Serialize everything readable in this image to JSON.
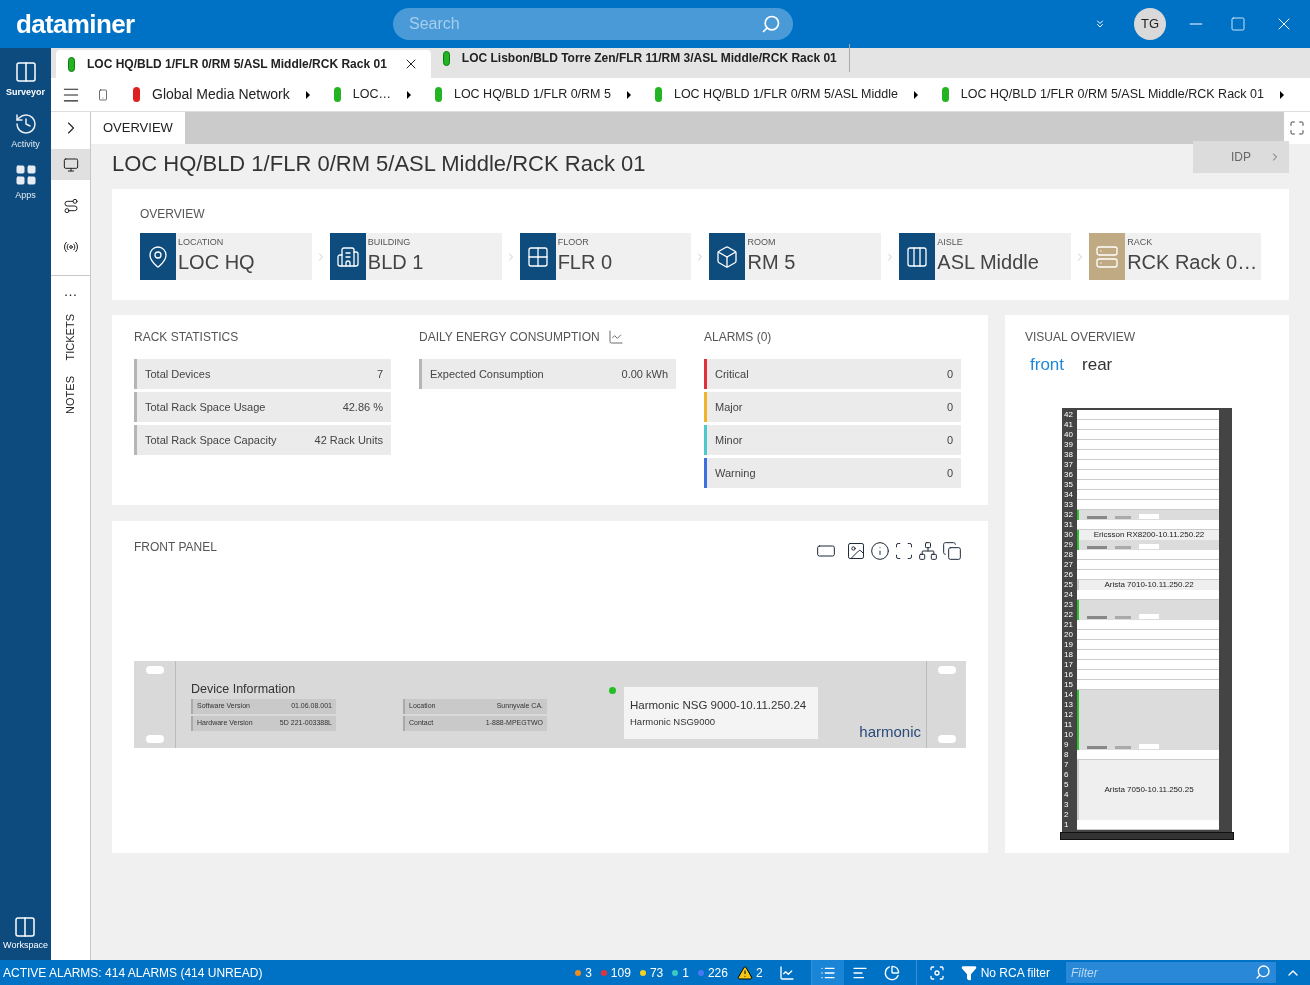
{
  "header": {
    "logo": "dataminer",
    "search": {
      "placeholder": "Search"
    },
    "avatar": "TG"
  },
  "rail": {
    "items": [
      {
        "kind": "surveyor",
        "label": "Surveyor",
        "selected": true
      },
      {
        "kind": "activity",
        "label": "Activity",
        "selected": false
      },
      {
        "kind": "apps",
        "label": "Apps",
        "selected": false
      }
    ],
    "workspace": "Workspace"
  },
  "tabs": [
    {
      "label": "LOC HQ/BLD 1/FLR 0/RM 5/ASL Middle/RCK Rack 01",
      "selected": true
    },
    {
      "label": "LOC Lisbon/BLD Torre Zen/FLR 11/RM 3/ASL Middle/RCK Rack 01",
      "selected": false
    }
  ],
  "breadcrumb": [
    {
      "label": "Global Media Network",
      "color": "#e02020"
    },
    {
      "label": "LOC…",
      "color": "#22b422"
    },
    {
      "label": "LOC HQ/BLD 1/FLR 0/RM 5",
      "color": "#22b422"
    },
    {
      "label": "LOC HQ/BLD 1/FLR 0/RM 5/ASL Middle",
      "color": "#22b422"
    },
    {
      "label": "LOC HQ/BLD 1/FLR 0/RM 5/ASL Middle/RCK Rack 01",
      "color": "#22b422"
    }
  ],
  "side_panel": {
    "tools": [
      {
        "kind": "card",
        "selected": true
      },
      {
        "kind": "route",
        "selected": false
      },
      {
        "kind": "broadcast",
        "selected": false
      }
    ],
    "more": "…",
    "vertical_tabs": [
      "TICKETS",
      "NOTES"
    ]
  },
  "page_tabs": [
    {
      "label": "OVERVIEW",
      "selected": true
    }
  ],
  "title": "LOC HQ/BLD 1/FLR 0/RM 5/ASL Middle/RCK Rack 01",
  "idp_button": "IDP",
  "overview": {
    "heading": "OVERVIEW",
    "items": [
      {
        "kind": "location",
        "caption": "LOCATION",
        "value": "LOC HQ"
      },
      {
        "kind": "building",
        "caption": "BUILDING",
        "value": "BLD 1"
      },
      {
        "kind": "floor",
        "caption": "FLOOR",
        "value": "FLR 0"
      },
      {
        "kind": "room",
        "caption": "ROOM",
        "value": "RM 5"
      },
      {
        "kind": "aisle",
        "caption": "AISLE",
        "value": "ASL Middle"
      },
      {
        "kind": "rack",
        "caption": "RACK",
        "value": "RCK Rack 0…"
      }
    ]
  },
  "rack_statistics": {
    "heading": "RACK STATISTICS",
    "rows": [
      {
        "label": "Total Devices",
        "value": "7"
      },
      {
        "label": "Total Rack Space Usage",
        "value": "42.86 %"
      },
      {
        "label": "Total Rack Space Capacity",
        "value": "42 Rack Units"
      }
    ]
  },
  "energy": {
    "heading": "DAILY ENERGY CONSUMPTION",
    "rows": [
      {
        "label": "Expected Consumption",
        "value": "0.00 kWh"
      }
    ]
  },
  "alarms": {
    "heading": "ALARMS (0)",
    "rows": [
      {
        "label": "Critical",
        "value": "0",
        "color": "#e0303a"
      },
      {
        "label": "Major",
        "value": "0",
        "color": "#f0b429"
      },
      {
        "label": "Minor",
        "value": "0",
        "color": "#4ec8c8"
      },
      {
        "label": "Warning",
        "value": "0",
        "color": "#3c6fe0"
      }
    ]
  },
  "front_panel": {
    "heading": "FRONT PANEL",
    "tools": [
      {
        "kind": "slot"
      },
      {
        "kind": "picture"
      },
      {
        "kind": "info"
      },
      {
        "kind": "fit"
      },
      {
        "kind": "network"
      },
      {
        "kind": "copy"
      }
    ],
    "device": {
      "heading": "Device Information",
      "left": [
        {
          "label": "Software Version",
          "value": "01.06.08.001"
        },
        {
          "label": "Hardware Version",
          "value": "5D 221-003388L"
        }
      ],
      "right": [
        {
          "label": "Location",
          "value": "Sunnyvale CA."
        },
        {
          "label": "Contact",
          "value": "1-888-MPEGTWO"
        }
      ],
      "name": "Harmonic NSG 9000-10.11.250.24",
      "model": "Harmonic NSG9000",
      "brand": "harmonic",
      "led_on": true
    }
  },
  "visual_overview": {
    "heading": "VISUAL OVERVIEW",
    "views": [
      {
        "label": "front",
        "selected": true
      },
      {
        "label": "rear",
        "selected": false
      }
    ],
    "rack": [
      {
        "kind": "empty",
        "numbers": [
          "42",
          "41",
          "40",
          "39",
          "38",
          "37",
          "36",
          "35",
          "34",
          "33"
        ]
      },
      {
        "kind": "panel",
        "numbers": [
          "32"
        ],
        "active": true
      },
      {
        "kind": "empty",
        "numbers": [
          "31"
        ]
      },
      {
        "kind": "label",
        "numbers": [
          "30"
        ],
        "label": "Ericsson RX8200-10.11.250.22",
        "active": true
      },
      {
        "kind": "panel",
        "numbers": [
          "29"
        ],
        "active": true
      },
      {
        "kind": "empty",
        "numbers": [
          "28",
          "27",
          "26"
        ]
      },
      {
        "kind": "label",
        "numbers": [
          "25"
        ],
        "label": "Arista 7010-10.11.250.22",
        "active": false
      },
      {
        "kind": "empty",
        "numbers": [
          "24"
        ]
      },
      {
        "kind": "panel",
        "numbers": [
          "23",
          "22"
        ],
        "active": true
      },
      {
        "kind": "empty",
        "numbers": [
          "21",
          "20",
          "19",
          "18",
          "17",
          "16",
          "15"
        ]
      },
      {
        "kind": "panel",
        "numbers": [
          "14",
          "13",
          "12",
          "11",
          "10",
          "9"
        ],
        "active": true
      },
      {
        "kind": "empty",
        "numbers": [
          "8"
        ]
      },
      {
        "kind": "label",
        "numbers": [
          "7",
          "6",
          "5",
          "4",
          "3",
          "2"
        ],
        "label": "Arista 7050-10.11.250.25",
        "active": false
      },
      {
        "kind": "empty",
        "numbers": [
          "1"
        ]
      }
    ]
  },
  "status_bar": {
    "alarms": "ACTIVE ALARMS: 414 ALARMS (414 UNREAD)",
    "counts": [
      {
        "value": "3",
        "color": "#f08c1e"
      },
      {
        "value": "109",
        "color": "#e8303a"
      },
      {
        "value": "73",
        "color": "#f0d020"
      },
      {
        "value": "1",
        "color": "#40c8c0"
      },
      {
        "value": "226",
        "color": "#4a78f0"
      }
    ],
    "warnings": "2",
    "views": [
      {
        "kind": "list",
        "selected": true
      },
      {
        "kind": "sort",
        "selected": false
      },
      {
        "kind": "pie",
        "selected": false
      }
    ],
    "rca": "No RCA filter",
    "filter": {
      "placeholder": "Filter"
    }
  }
}
